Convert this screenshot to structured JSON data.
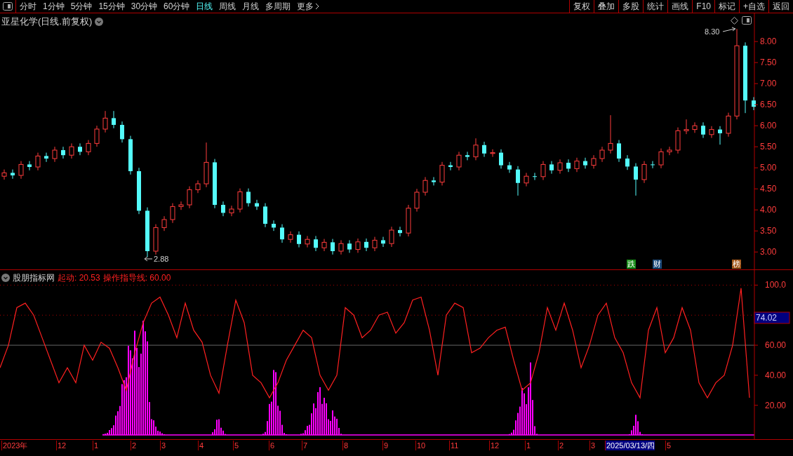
{
  "toolbar": {
    "periods": [
      {
        "label": "分时",
        "selected": false
      },
      {
        "label": "1分钟",
        "selected": false
      },
      {
        "label": "5分钟",
        "selected": false
      },
      {
        "label": "15分钟",
        "selected": false
      },
      {
        "label": "30分钟",
        "selected": false
      },
      {
        "label": "60分钟",
        "selected": false
      },
      {
        "label": "日线",
        "selected": true
      },
      {
        "label": "周线",
        "selected": false
      },
      {
        "label": "月线",
        "selected": false
      },
      {
        "label": "多周期",
        "selected": false
      },
      {
        "label": "更多",
        "selected": false
      }
    ],
    "actions": [
      "复权",
      "叠加",
      "多股",
      "统计",
      "画线",
      "F10",
      "标记",
      "+自选",
      "返回"
    ]
  },
  "price_panel": {
    "title": "亚星化学(日线.前复权)",
    "high_marker": "8.30",
    "low_marker": "2.88",
    "badges": [
      {
        "label": "跌",
        "color": "#158a15"
      },
      {
        "label": "财",
        "color": "#1d4a7a"
      },
      {
        "label": "榜",
        "color": "#a35618"
      }
    ],
    "chart_data": {
      "type": "candlestick",
      "ylim": [
        2.57,
        8.67
      ],
      "yticks": [
        {
          "value": 8,
          "label": "8.00"
        },
        {
          "value": 7.5,
          "label": "7.50"
        },
        {
          "value": 7,
          "label": "7.00"
        },
        {
          "value": 6.5,
          "label": "6.50"
        },
        {
          "value": 6,
          "label": "6.00"
        },
        {
          "value": 5.5,
          "label": "5.50"
        },
        {
          "value": 5,
          "label": "5.00"
        },
        {
          "value": 4.5,
          "label": "4.50"
        },
        {
          "value": 4,
          "label": "4.00"
        },
        {
          "value": 3.5,
          "label": "3.50"
        },
        {
          "value": 3,
          "label": "3.00"
        }
      ],
      "ohlc": [
        [
          4.8,
          4.96,
          4.72,
          4.88
        ],
        [
          4.88,
          4.96,
          4.74,
          4.82
        ],
        [
          4.82,
          5.16,
          4.74,
          5.08
        ],
        [
          5.08,
          5.16,
          4.94,
          5.02
        ],
        [
          5.02,
          5.36,
          4.94,
          5.28
        ],
        [
          5.28,
          5.36,
          5.14,
          5.22
        ],
        [
          5.22,
          5.5,
          5.14,
          5.42
        ],
        [
          5.42,
          5.5,
          5.22,
          5.3
        ],
        [
          5.3,
          5.58,
          5.22,
          5.5
        ],
        [
          5.5,
          5.58,
          5.3,
          5.38
        ],
        [
          5.38,
          5.66,
          5.3,
          5.58
        ],
        [
          5.58,
          6.0,
          5.5,
          5.92
        ],
        [
          5.92,
          6.35,
          5.84,
          6.18
        ],
        [
          6.18,
          6.35,
          5.94,
          6.02
        ],
        [
          6.02,
          6.1,
          5.6,
          5.68
        ],
        [
          5.68,
          5.76,
          4.84,
          4.92
        ],
        [
          4.92,
          5.0,
          3.9,
          3.98
        ],
        [
          3.98,
          4.06,
          2.88,
          3.02
        ],
        [
          3.02,
          3.66,
          2.94,
          3.58
        ],
        [
          3.58,
          3.85,
          3.5,
          3.77
        ],
        [
          3.77,
          4.16,
          3.69,
          4.08
        ],
        [
          4.08,
          4.2,
          4.0,
          4.12
        ],
        [
          4.12,
          4.56,
          4.04,
          4.48
        ],
        [
          4.48,
          4.7,
          4.4,
          4.62
        ],
        [
          4.62,
          5.6,
          4.54,
          5.13
        ],
        [
          5.13,
          5.21,
          4.04,
          4.12
        ],
        [
          4.12,
          4.2,
          3.85,
          3.93
        ],
        [
          3.93,
          4.1,
          3.85,
          4.02
        ],
        [
          4.02,
          4.51,
          3.94,
          4.43
        ],
        [
          4.43,
          4.51,
          4.08,
          4.16
        ],
        [
          4.16,
          4.24,
          4.0,
          4.08
        ],
        [
          4.08,
          4.16,
          3.59,
          3.67
        ],
        [
          3.67,
          3.75,
          3.5,
          3.58
        ],
        [
          3.58,
          3.66,
          3.22,
          3.3
        ],
        [
          3.3,
          3.49,
          3.22,
          3.41
        ],
        [
          3.41,
          3.49,
          3.11,
          3.19
        ],
        [
          3.19,
          3.38,
          3.11,
          3.3
        ],
        [
          3.3,
          3.38,
          3.02,
          3.1
        ],
        [
          3.1,
          3.31,
          3.02,
          3.23
        ],
        [
          3.23,
          3.31,
          2.94,
          3.02
        ],
        [
          3.02,
          3.28,
          2.94,
          3.2
        ],
        [
          3.2,
          3.28,
          2.98,
          3.06
        ],
        [
          3.06,
          3.32,
          2.98,
          3.24
        ],
        [
          3.24,
          3.32,
          3.02,
          3.1
        ],
        [
          3.1,
          3.36,
          3.02,
          3.28
        ],
        [
          3.28,
          3.36,
          3.12,
          3.2
        ],
        [
          3.2,
          3.6,
          3.12,
          3.52
        ],
        [
          3.52,
          3.6,
          3.37,
          3.45
        ],
        [
          3.45,
          4.12,
          3.37,
          4.04
        ],
        [
          4.04,
          4.5,
          3.96,
          4.42
        ],
        [
          4.42,
          4.78,
          4.34,
          4.7
        ],
        [
          4.7,
          4.78,
          4.58,
          4.66
        ],
        [
          4.66,
          5.14,
          4.58,
          5.06
        ],
        [
          5.06,
          5.14,
          4.94,
          5.02
        ],
        [
          5.02,
          5.38,
          4.94,
          5.3
        ],
        [
          5.3,
          5.38,
          5.18,
          5.26
        ],
        [
          5.26,
          5.7,
          5.18,
          5.54
        ],
        [
          5.54,
          5.62,
          5.26,
          5.34
        ],
        [
          5.34,
          5.44,
          5.26,
          5.36
        ],
        [
          5.36,
          5.44,
          4.98,
          5.06
        ],
        [
          5.06,
          5.14,
          4.88,
          4.96
        ],
        [
          4.96,
          5.04,
          4.34,
          4.64
        ],
        [
          4.64,
          4.88,
          4.56,
          4.8
        ],
        [
          4.8,
          4.88,
          4.71,
          4.79
        ],
        [
          4.79,
          5.16,
          4.71,
          5.08
        ],
        [
          5.08,
          5.16,
          4.86,
          4.94
        ],
        [
          4.94,
          5.2,
          4.86,
          5.12
        ],
        [
          5.12,
          5.2,
          4.9,
          4.98
        ],
        [
          4.98,
          5.24,
          4.9,
          5.16
        ],
        [
          5.16,
          5.24,
          4.98,
          5.06
        ],
        [
          5.06,
          5.3,
          4.98,
          5.22
        ],
        [
          5.22,
          5.5,
          5.14,
          5.42
        ],
        [
          5.42,
          6.25,
          5.34,
          5.58
        ],
        [
          5.58,
          5.66,
          5.14,
          5.22
        ],
        [
          5.22,
          5.3,
          4.95,
          5.03
        ],
        [
          5.03,
          5.11,
          4.34,
          4.72
        ],
        [
          4.72,
          5.16,
          4.64,
          5.08
        ],
        [
          5.08,
          5.16,
          4.99,
          5.07
        ],
        [
          5.07,
          5.46,
          4.99,
          5.38
        ],
        [
          5.38,
          5.5,
          5.3,
          5.42
        ],
        [
          5.42,
          5.96,
          5.34,
          5.88
        ],
        [
          5.88,
          6.15,
          5.8,
          5.91
        ],
        [
          5.91,
          6.08,
          5.83,
          6.0
        ],
        [
          6.0,
          6.08,
          5.71,
          5.79
        ],
        [
          5.79,
          5.99,
          5.71,
          5.91
        ],
        [
          5.91,
          5.99,
          5.55,
          5.82
        ],
        [
          5.82,
          6.31,
          5.74,
          6.23
        ],
        [
          6.23,
          8.3,
          6.15,
          7.9
        ],
        [
          7.9,
          7.98,
          6.3,
          6.6
        ],
        [
          6.6,
          6.68,
          6.37,
          6.45
        ]
      ]
    }
  },
  "indicator_panel": {
    "name": "股朋指标网",
    "readings": [
      "起动: 20.53",
      "操作指导线: 60.00"
    ],
    "current_value": "74.02",
    "chart_data": {
      "type": "line",
      "ylim": [
        -3,
        110
      ],
      "yticks": [
        {
          "value": 100,
          "label": "100.0"
        },
        {
          "value": 60,
          "label": "60.00"
        },
        {
          "value": 40,
          "label": "40.00"
        },
        {
          "value": 20,
          "label": "20.00"
        }
      ],
      "series": [
        {
          "color": "#ff2020",
          "values": [
            45,
            60,
            85,
            88,
            80,
            65,
            50,
            35,
            45,
            35,
            60,
            50,
            62,
            58,
            45,
            30,
            55,
            75,
            88,
            92,
            80,
            65,
            88,
            70,
            62,
            40,
            28,
            60,
            90,
            75,
            40,
            35,
            25,
            35,
            50,
            60,
            70,
            65,
            40,
            30,
            40,
            85,
            80,
            65,
            70,
            80,
            82,
            68,
            75,
            90,
            92,
            70,
            40,
            80,
            88,
            85,
            55,
            58,
            65,
            70,
            72,
            50,
            30,
            35,
            55,
            85,
            70,
            88,
            70,
            45,
            60,
            80,
            88,
            65,
            55,
            35,
            25,
            70,
            85,
            55,
            65,
            85,
            70,
            35,
            25,
            35,
            40,
            60,
            98,
            25
          ]
        }
      ]
    }
  },
  "date_axis": {
    "labels": [
      {
        "label": "2023年",
        "selected": false
      },
      {
        "label": "12",
        "selected": false
      },
      {
        "label": "1",
        "selected": false
      },
      {
        "label": "2",
        "selected": false
      },
      {
        "label": "3",
        "selected": false
      },
      {
        "label": "4",
        "selected": false
      },
      {
        "label": "5",
        "selected": false
      },
      {
        "label": "6",
        "selected": false
      },
      {
        "label": "7",
        "selected": false
      },
      {
        "label": "8",
        "selected": false
      },
      {
        "label": "9",
        "selected": false
      },
      {
        "label": "10",
        "selected": false
      },
      {
        "label": "11",
        "selected": false
      },
      {
        "label": "12",
        "selected": false
      },
      {
        "label": "1",
        "selected": false
      },
      {
        "label": "2",
        "selected": false
      },
      {
        "label": "3",
        "selected": false
      },
      {
        "label": "2025/03/13/四",
        "selected": true
      },
      {
        "label": "5",
        "selected": false
      }
    ]
  }
}
